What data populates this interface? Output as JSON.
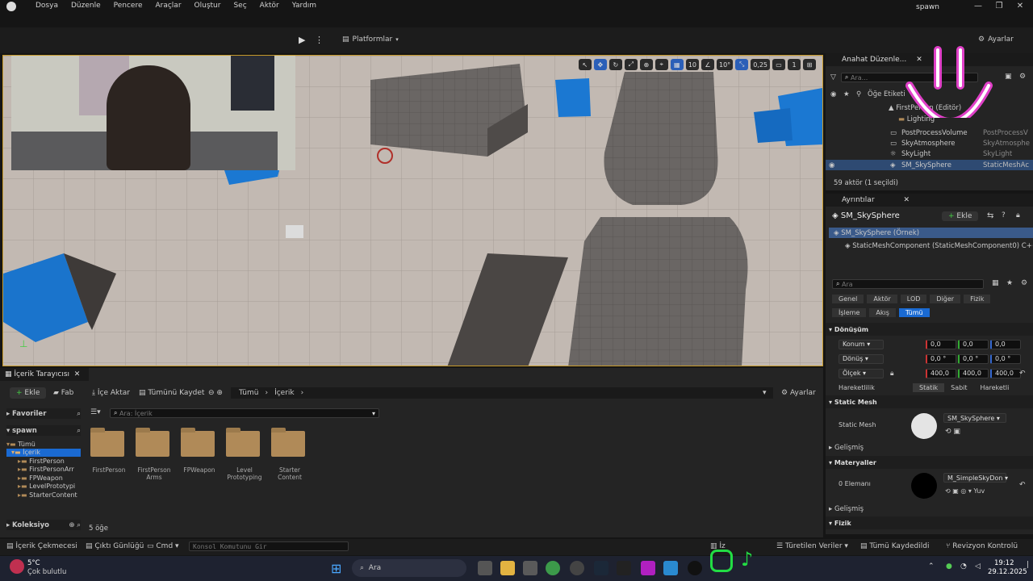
{
  "menu": [
    "Dosya",
    "Düzenle",
    "Pencere",
    "Araçlar",
    "Oluştur",
    "Seç",
    "Aktör",
    "Yardım"
  ],
  "window": {
    "title": "spawn",
    "min": "—",
    "restore": "❐",
    "close": "✕"
  },
  "toolbar": {
    "platforms": "Platformlar",
    "settings": "Ayarlar"
  },
  "viewport": {
    "grid_value": "10",
    "angle_value": "10°",
    "scale_value": "0,25",
    "camera_value": "1"
  },
  "outliner": {
    "tab": "Anahat Düzenle...",
    "search": "Ara...",
    "column_label": "Öğe Etiketi",
    "rows": [
      {
        "label": "FirstPerson",
        "type": "(Editör)"
      },
      {
        "label": "Lighting",
        "type": ""
      },
      {
        "label": "PostProcessVolume",
        "type": "PostProcessV"
      },
      {
        "label": "SkyAtmosphere",
        "type": "SkyAtmosphe"
      },
      {
        "label": "SkyLight",
        "type": "SkyLight"
      },
      {
        "label": "SM_SkySphere",
        "type": "StaticMeshAc"
      }
    ],
    "status": "59 aktör (1 seçildi)"
  },
  "details": {
    "tab": "Ayrıntılar",
    "object": "SM_SkySphere",
    "add": "Ekle",
    "instance": "SM_SkySphere (Örnek)",
    "component": "StaticMeshComponent (StaticMeshComponent0)",
    "cpp": "C++",
    "search": "Ara",
    "filters": [
      "Genel",
      "Aktör",
      "LOD",
      "Diğer",
      "Fizik",
      "İşleme",
      "Akış",
      "Tümü"
    ],
    "transform_title": "Dönüşüm",
    "location": {
      "label": "Konum",
      "x": "0,0",
      "y": "0,0",
      "z": "0,0"
    },
    "rotation": {
      "label": "Dönüş",
      "x": "0,0 °",
      "y": "0,0 °",
      "z": "0,0 °"
    },
    "scale": {
      "label": "Ölçek",
      "x": "400,0",
      "y": "400,0",
      "z": "400,0"
    },
    "mobility": {
      "label": "Hareketlilik",
      "options": [
        "Statik",
        "Sabit",
        "Hareketli"
      ]
    },
    "static_mesh_title": "Static Mesh",
    "static_mesh_label": "Static Mesh",
    "static_mesh_value": "SM_SkySphere",
    "advanced": "Gelişmiş",
    "materials_title": "Materyaller",
    "materials_count": "0 Elemanı",
    "material_value": "M_SimpleSkyDon",
    "material_extra": "Yuv",
    "advanced2": "Gelişmiş",
    "physics_title": "Fizik"
  },
  "content": {
    "tab": "İçerik Tarayıcısı",
    "add": "Ekle",
    "fab": "Fab",
    "import": "İçe Aktar",
    "save_all": "Tümünü Kaydet",
    "crumbs": [
      "Tümü",
      "İçerik"
    ],
    "settings": "Ayarlar",
    "favorites": "Favoriler",
    "project": "spawn",
    "tree": [
      "Tümü",
      "İçerik",
      "FirstPerson",
      "FirstPersonArr",
      "FPWeapon",
      "LevelPrototypi",
      "StarterContent"
    ],
    "collections": "Koleksiyo",
    "search": "Ara: İçerik",
    "folders": [
      [
        "FirstPerson",
        ""
      ],
      [
        "FirstPerson",
        "Arms"
      ],
      [
        "FPWeapon",
        ""
      ],
      [
        "Level",
        "Prototyping"
      ],
      [
        "Starter",
        "Content"
      ]
    ],
    "count": "5 öğe"
  },
  "statusbar": {
    "drawer": "İçerik Çekmecesi",
    "log": "Çıktı Günlüğü",
    "cmd": "Cmd",
    "console_placeholder": "Konsol Komutunu Gir",
    "derived": "Türetilen Veriler",
    "saved": "Tümü Kaydedildi",
    "revision": "Revizyon Kontrolü",
    "trace": "İz"
  },
  "taskbar": {
    "weather_temp": "5°C",
    "weather_desc": "Çok bulutlu",
    "search": "Ara",
    "time": "19:12",
    "date": "29.12.2025"
  }
}
